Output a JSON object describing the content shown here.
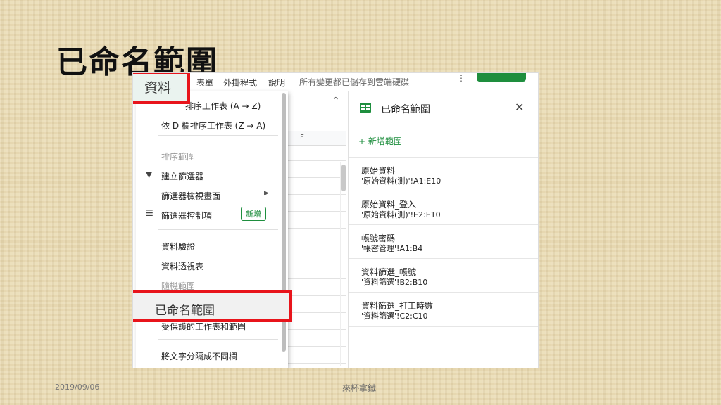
{
  "slide": {
    "title": "已命名範圍",
    "footer_date": "2019/09/06",
    "footer_author": "來杯拿鐵"
  },
  "app": {
    "menubar": [
      "表單",
      "外掛程式",
      "說明"
    ],
    "save_status": "所有變更都已儲存到雲端硬碟",
    "highlighted_menu": "資料"
  },
  "sheet": {
    "column_header": "F",
    "collapse_icon": "chevron-up-icon"
  },
  "data_menu": {
    "items": [
      {
        "label": "排序工作表 (A → Z)",
        "enabled": true
      },
      {
        "label": "依 D 欄排序工作表 (Z → A)",
        "enabled": true
      },
      {
        "label": "排序範圍",
        "enabled": false
      },
      {
        "label": "建立篩選器",
        "enabled": true,
        "icon": "filter-icon"
      },
      {
        "label": "篩選器檢視畫面",
        "enabled": true,
        "submenu": true
      },
      {
        "label": "篩選器控制項",
        "enabled": true,
        "icon": "filter-list-icon",
        "badge": "新增"
      },
      {
        "label": "資料驗證",
        "enabled": true
      },
      {
        "label": "資料透視表",
        "enabled": true
      },
      {
        "label": "隨機範圍",
        "enabled": false
      },
      {
        "label": "已命名範圍",
        "enabled": true,
        "highlighted": true
      },
      {
        "label": "受保護的工作表和範圍",
        "enabled": true
      },
      {
        "label": "將文字分隔成不同欄",
        "enabled": true
      }
    ]
  },
  "panel": {
    "title": "已命名範圍",
    "close_icon": "close-icon",
    "add_label": "+ 新增範圍",
    "ranges": [
      {
        "name": "原始資料",
        "ref": "'原始資料(測)'!A1:E10"
      },
      {
        "name": "原始資料_登入",
        "ref": "'原始資料(測)'!E2:E10"
      },
      {
        "name": "帳號密碼",
        "ref": "'帳密管理'!A1:B4"
      },
      {
        "name": "資料篩選_帳號",
        "ref": "'資料篩選'!B2:B10"
      },
      {
        "name": "資料篩選_打工時數",
        "ref": "'資料篩選'!C2:C10"
      }
    ]
  },
  "colors": {
    "highlight_red": "#e8141b",
    "sheets_green": "#1e8e3e"
  }
}
